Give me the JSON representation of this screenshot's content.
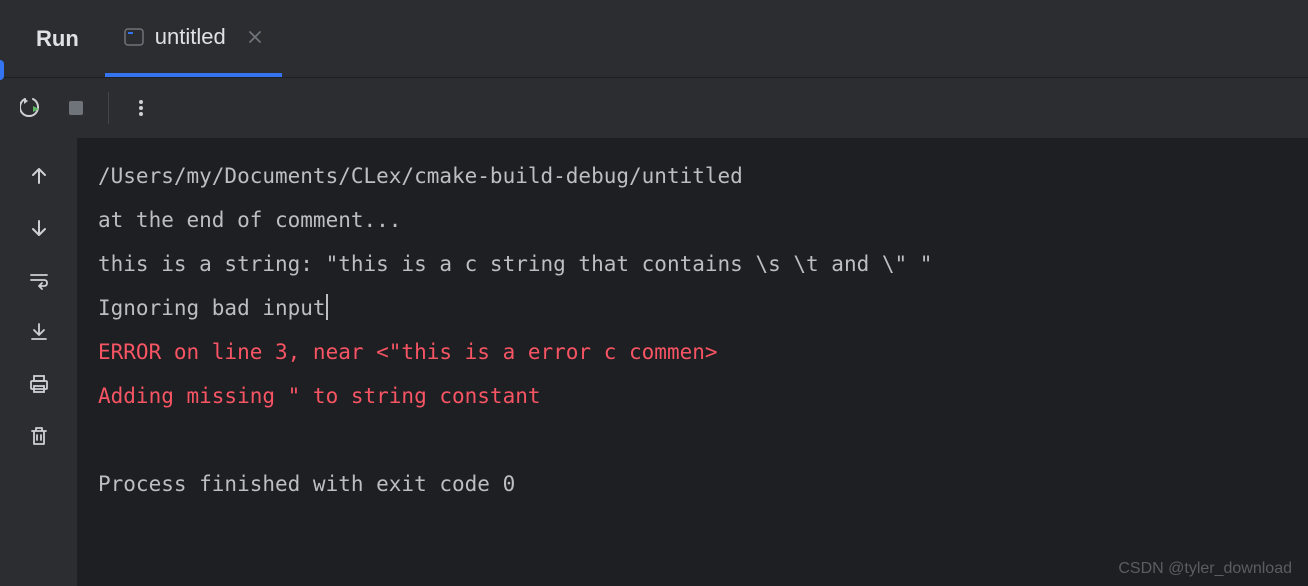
{
  "header": {
    "run_label": "Run",
    "tab": {
      "label": "untitled"
    }
  },
  "console": {
    "lines": [
      {
        "text": "/Users/my/Documents/CLex/cmake-build-debug/untitled",
        "type": "normal"
      },
      {
        "text": "at the end of comment...",
        "type": "normal"
      },
      {
        "text": "this is a string: \"this is a c string that contains \\s \\t and \\\" \"",
        "type": "normal"
      },
      {
        "text": "Ignoring bad input",
        "type": "normal",
        "cursor": true
      },
      {
        "text": "ERROR on line 3, near <\"this is a error c commen>",
        "type": "error"
      },
      {
        "text": "Adding missing \" to string constant",
        "type": "error"
      },
      {
        "text": "",
        "type": "normal"
      },
      {
        "text": "Process finished with exit code 0",
        "type": "normal"
      }
    ]
  },
  "watermark": "CSDN @tyler_download"
}
